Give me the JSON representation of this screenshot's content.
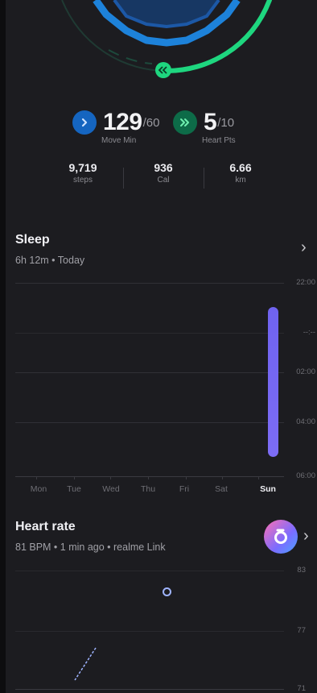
{
  "activity": {
    "move_min": {
      "value": "129",
      "goal": "/60",
      "label": "Move Min",
      "progress": 2.15
    },
    "heart_pts": {
      "value": "5",
      "goal": "/10",
      "label": "Heart Pts",
      "progress": 0.5
    },
    "steps": {
      "value": "9,719",
      "label": "steps"
    },
    "calories": {
      "value": "936",
      "label": "Cal"
    },
    "distance": {
      "value": "6.66",
      "label": "km"
    }
  },
  "sleep": {
    "title": "Sleep",
    "subtitle": "6h 12m • Today",
    "time_labels": [
      "22:00",
      "--:--",
      "02:00",
      "04:00",
      "06:00"
    ],
    "days": [
      "Mon",
      "Tue",
      "Wed",
      "Thu",
      "Fri",
      "Sat",
      "Sun"
    ],
    "selected_day": "Sun",
    "bar_color": "#7466f2"
  },
  "heart_rate": {
    "title": "Heart rate",
    "subtitle": "81 BPM • 1 min ago • realme Link",
    "y_labels": [
      "83",
      "77",
      "71"
    ]
  },
  "colors": {
    "move_ring": "#1e88e5",
    "heart_ring": "#1ed67f",
    "sleep_bar": "#7466f2",
    "background": "#1c1c20"
  },
  "icons": {
    "move": "chevron-right-icon",
    "heart": "double-chevron-right-icon",
    "app": "realme-link-app-icon",
    "chevron": "chevron-right-icon"
  }
}
